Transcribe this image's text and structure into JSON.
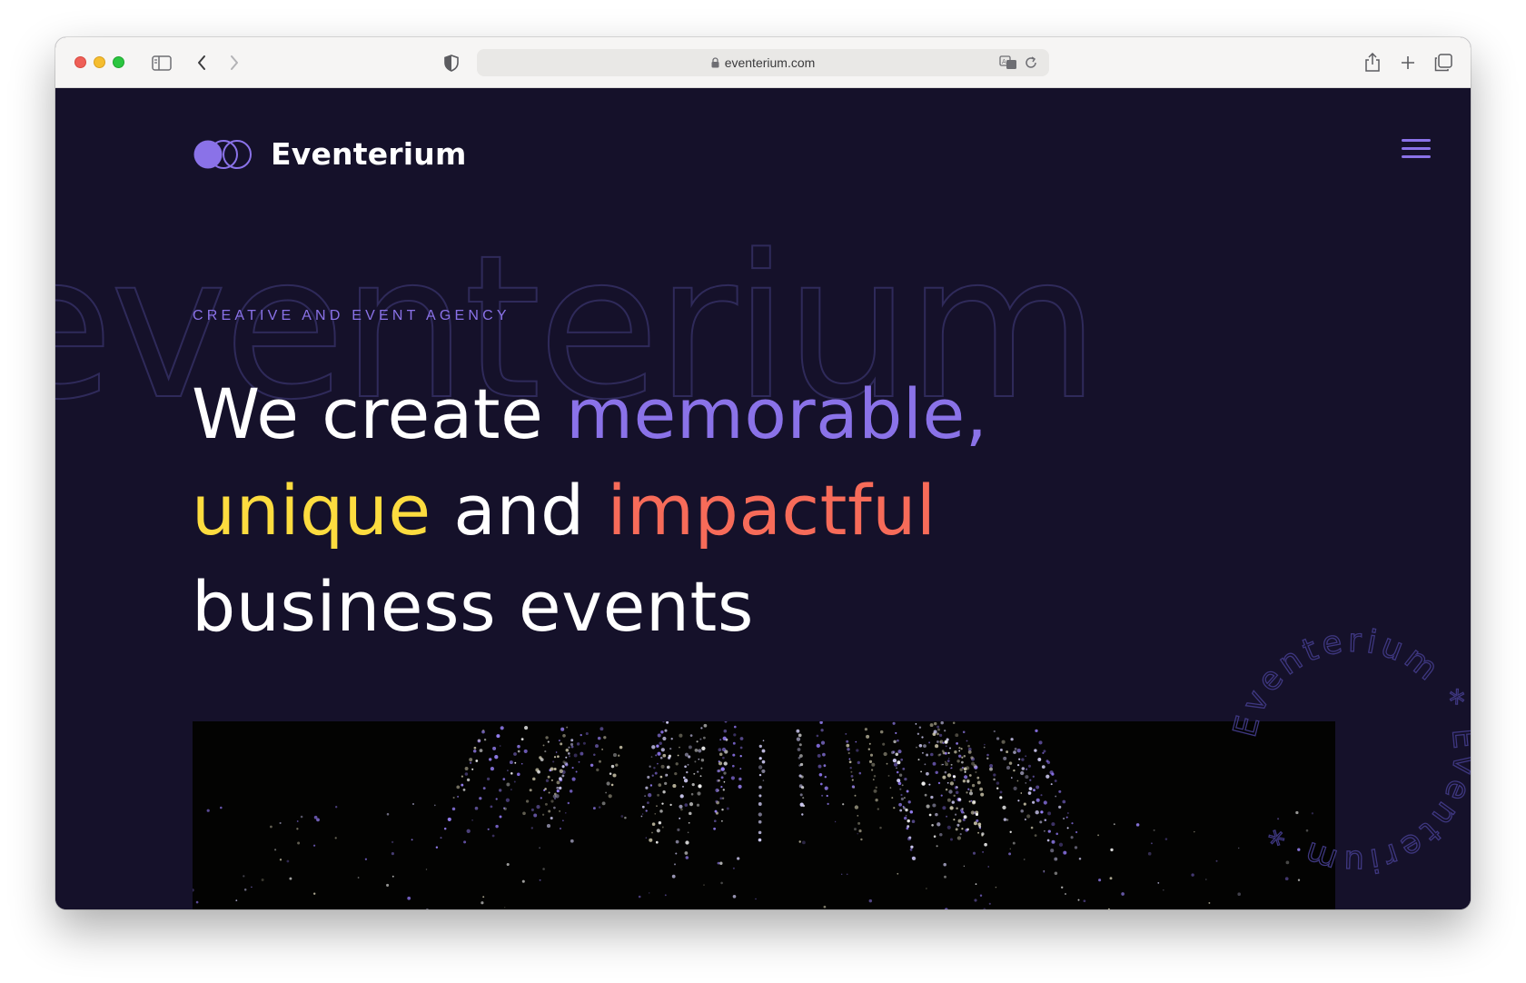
{
  "browser": {
    "url": "eventerium.com",
    "icons": [
      "sidebar-icon",
      "back-icon",
      "forward-icon",
      "shield-icon",
      "lock-icon",
      "translate-icon",
      "reload-icon",
      "share-icon",
      "new-tab-icon",
      "tabs-overview-icon"
    ]
  },
  "site": {
    "logo_text": "Eventerium",
    "menu_icon": "hamburger-menu-icon",
    "background_word": "eventerium",
    "eyebrow": "CREATIVE AND EVENT AGENCY",
    "headline": {
      "w1": "We create ",
      "w2": "memorable,",
      "w3": "unique",
      "w4": " and ",
      "w5": "impactful",
      "w6": "business events"
    },
    "badge_text": "Eventerium * Eventerium * ",
    "colors": {
      "background": "#15112a",
      "accent_purple": "#8a72e8",
      "accent_yellow": "#fddc3f",
      "accent_coral": "#f76b59",
      "outline": "#2f2a5a"
    }
  }
}
